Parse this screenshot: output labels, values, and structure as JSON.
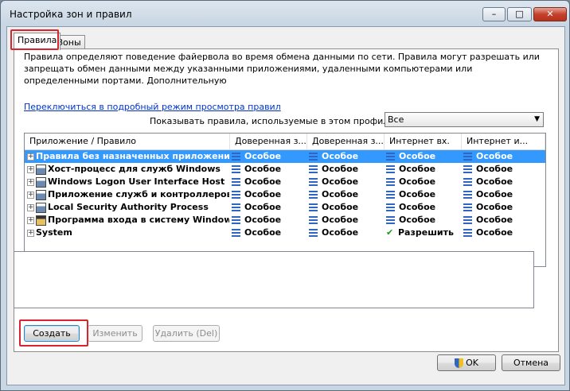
{
  "window": {
    "title": "Настройка зон и правил"
  },
  "titlebar_buttons": {
    "min": "–",
    "max": "□",
    "close": "✕"
  },
  "tabs": [
    {
      "label": "Правила",
      "active": true
    },
    {
      "label": "Зоны",
      "active": false
    }
  ],
  "description": "Правила определяют поведение файервола во время обмена данными по сети. Правила могут разрешать или запрещать обмен данными между указанными приложениями, удаленными компьютерами или определенными портами. Дополнительную",
  "detailed_view_link": "Переключиться в подробный режим просмотра правил",
  "profile_filter": {
    "label": "Показывать правила, используемые в этом профиле:",
    "value": "Все"
  },
  "columns": [
    "Приложение / Правило",
    "Доверенная з...",
    "Доверенная з...",
    "Интернет вх.",
    "Интернет и..."
  ],
  "rows": [
    {
      "name": "Правила без назначенных приложений",
      "selected": true,
      "icon": "none",
      "values": [
        "Особое",
        "Особое",
        "Особое",
        "Особое"
      ]
    },
    {
      "name": "Хост-процесс для служб Windows",
      "selected": false,
      "icon": "application-icon",
      "values": [
        "Особое",
        "Особое",
        "Особое",
        "Особое"
      ]
    },
    {
      "name": "Windows Logon User Interface Host",
      "selected": false,
      "icon": "application-icon",
      "values": [
        "Особое",
        "Особое",
        "Особое",
        "Особое"
      ]
    },
    {
      "name": "Приложение служб и контроллеров",
      "selected": false,
      "icon": "application-icon",
      "values": [
        "Особое",
        "Особое",
        "Особое",
        "Особое"
      ]
    },
    {
      "name": "Local Security Authority Process",
      "selected": false,
      "icon": "application-icon",
      "values": [
        "Особое",
        "Особое",
        "Особое",
        "Особое"
      ]
    },
    {
      "name": "Программа входа в систему Windows",
      "selected": false,
      "icon": "logon-icon",
      "values": [
        "Особое",
        "Особое",
        "Особое",
        "Особое"
      ]
    },
    {
      "name": "System",
      "selected": false,
      "icon": "none",
      "values": [
        "Особое",
        "Особое",
        "Разрешить",
        "Особое"
      ],
      "allow_index": 2
    }
  ],
  "buttons": {
    "create": "Создать",
    "edit": "Изменить",
    "delete": "Удалить (Del)",
    "ok": "OK",
    "cancel": "Отмена"
  },
  "colors": {
    "selection": "#3399ff",
    "link": "#0033cc",
    "highlight_box": "#d9232d",
    "allow_check": "#1c9a1c"
  }
}
